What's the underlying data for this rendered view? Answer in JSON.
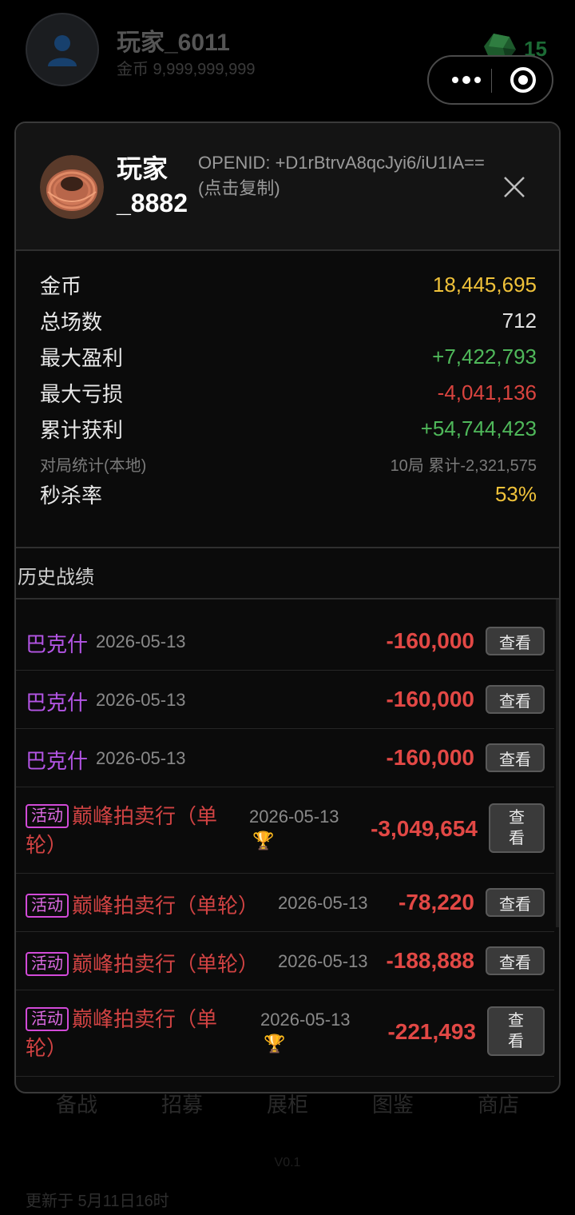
{
  "background": {
    "username": "玩家_6011",
    "coins": "金币 9,999,999,999",
    "gem_count": "15",
    "nav": [
      "备战",
      "招募",
      "展柜",
      "图鉴",
      "商店"
    ],
    "version": "V0.1",
    "updated": "更新于 5月11日16时"
  },
  "modal": {
    "player_name": "玩家_8882",
    "openid_text": "OPENID: +D1rBtrvA8qcJyi6/iU1IA== (点击复制)",
    "stats": [
      {
        "label": "金币",
        "value": "18,445,695",
        "color": "#f0c23a"
      },
      {
        "label": "总场数",
        "value": "712",
        "color": "#e0e0e0"
      },
      {
        "label": "最大盈利",
        "value": "+7,422,793",
        "color": "#4fb85a"
      },
      {
        "label": "最大亏损",
        "value": "-4,041,136",
        "color": "#d9443f"
      },
      {
        "label": "累计获利",
        "value": "+54,744,423",
        "color": "#4fb85a"
      },
      {
        "label": "对局统计(本地)",
        "value": "10局 累计-2,321,575",
        "color": "#7a7a7a"
      },
      {
        "label": "秒杀率",
        "value": "53%",
        "color": "#f0c23a"
      }
    ],
    "history_title": "历史战绩",
    "history": [
      {
        "name": "巴克什",
        "date": "2026-05-13",
        "amount": "-160,000",
        "button": "查看"
      },
      {
        "name": "巴克什",
        "date": "2026-05-13",
        "amount": "-160,000",
        "button": "查看"
      },
      {
        "name": "巴克什",
        "date": "2026-05-13",
        "amount": "-160,000",
        "button": "查看"
      },
      {
        "badge": "活动",
        "name": "巅峰拍卖行（单轮）",
        "date": "2026-05-13",
        "amount": "-3,049,654",
        "button": "查看",
        "trophy": true
      },
      {
        "badge": "活动",
        "name": "巅峰拍卖行（单轮）",
        "date": "2026-05-13",
        "amount": "-78,220",
        "button": "查看"
      },
      {
        "badge": "活动",
        "name": "巅峰拍卖行（单轮）",
        "date": "2026-05-13",
        "amount": "-188,888",
        "button": "查看"
      },
      {
        "badge": "活动",
        "name": "巅峰拍卖行（单轮）",
        "date": "2026-05-13",
        "amount": "-221,493",
        "button": "查看",
        "trophy": true
      }
    ]
  }
}
